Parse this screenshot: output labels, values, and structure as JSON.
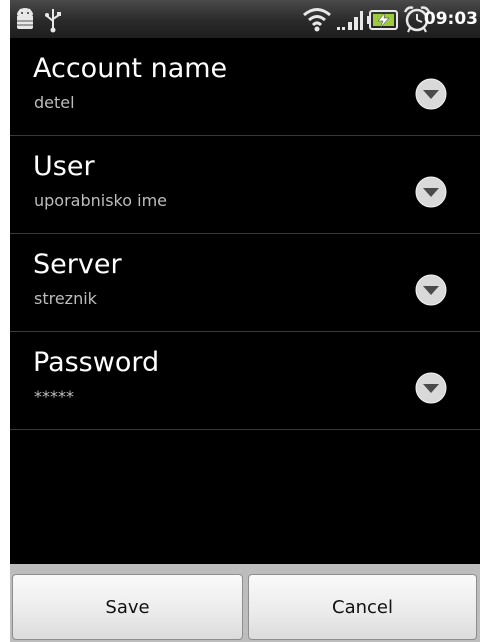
{
  "status_bar": {
    "time": "09:03",
    "icons": [
      "android-debug-icon",
      "usb-icon",
      "wifi-icon",
      "signal-icon",
      "battery-charging-icon",
      "alarm-icon"
    ]
  },
  "settings": [
    {
      "title": "Account name",
      "value": "detel"
    },
    {
      "title": "User",
      "value": "uporabnisko ime"
    },
    {
      "title": "Server",
      "value": "streznik"
    },
    {
      "title": "Password",
      "value": "*****"
    }
  ],
  "buttons": {
    "save_label": "Save",
    "cancel_label": "Cancel"
  },
  "colors": {
    "background": "#000000",
    "title_text": "#ffffff",
    "value_text": "#bdbdbd",
    "button_bar": "#bdbdbd"
  }
}
